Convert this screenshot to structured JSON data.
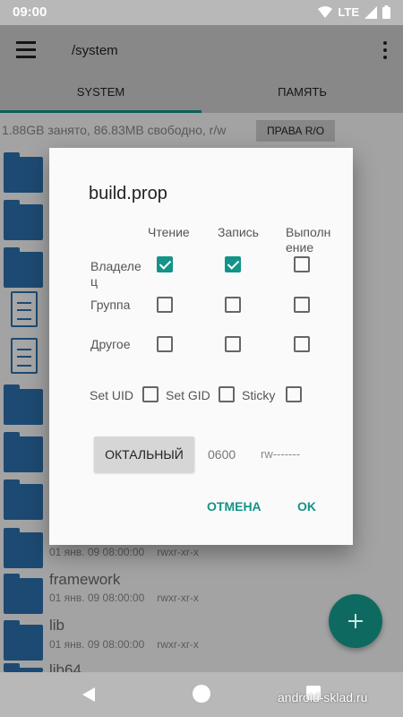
{
  "status_bar": {
    "time": "09:00",
    "network": "LTE"
  },
  "app_bar": {
    "path": "/system"
  },
  "tabs": [
    {
      "label": "SYSTEM"
    },
    {
      "label": "ПАМЯТЬ"
    }
  ],
  "storage": {
    "info": "1.88GB занято, 86.83MB свободно, r/w",
    "mount_button": "ПРАВА R/O"
  },
  "files": [
    {
      "name": "framework",
      "date": "01 янв. 09 08:00:00",
      "perms": "rwxr-xr-x"
    },
    {
      "name": "lib",
      "date": "01 янв. 09 08:00:00",
      "perms": "rwxr-xr-x"
    },
    {
      "name": "lib64",
      "date": "",
      "perms": ""
    }
  ],
  "partial_row": {
    "date": "01 янв. 09 08:00:00",
    "perms": "rwxr-xr-x"
  },
  "dialog": {
    "title": "build.prop",
    "columns": [
      "Чтение",
      "Запись",
      "Выполн\nение"
    ],
    "rows": [
      {
        "label": "Владеле\nц",
        "read": true,
        "write": true,
        "exec": false
      },
      {
        "label": "Группа",
        "read": false,
        "write": false,
        "exec": false
      },
      {
        "label": "Другое",
        "read": false,
        "write": false,
        "exec": false
      }
    ],
    "special": [
      {
        "label": "Set UID",
        "checked": false
      },
      {
        "label": "Set GID",
        "checked": false
      },
      {
        "label": "Sticky",
        "checked": false
      }
    ],
    "octal_button": "ОКТАЛЬНЫЙ",
    "octal_value": "0600",
    "symbolic_value": "rw-------",
    "cancel": "ОТМЕНА",
    "ok": "OK"
  },
  "watermark": "android-sklad.ru",
  "icons": [
    "menu-icon",
    "more-vert-icon",
    "wifi-icon",
    "signal-icon",
    "battery-icon",
    "folder-icon",
    "file-icon",
    "add-icon",
    "back-icon",
    "home-icon",
    "recents-icon"
  ],
  "colors": {
    "accent": "#129488",
    "fab": "#0e6a61",
    "folder": "#2d72b0"
  }
}
